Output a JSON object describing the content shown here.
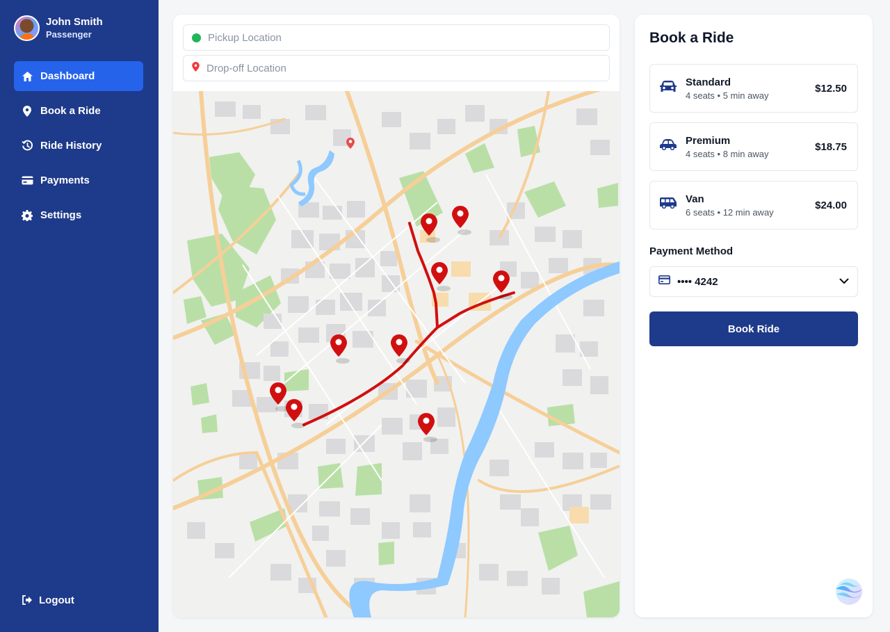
{
  "user": {
    "name": "John Smith",
    "role": "Passenger"
  },
  "nav": {
    "items": [
      {
        "label": "Dashboard",
        "icon": "home-icon",
        "active": true
      },
      {
        "label": "Book a Ride",
        "icon": "map-pin-icon"
      },
      {
        "label": "Ride History",
        "icon": "history-icon"
      },
      {
        "label": "Payments",
        "icon": "credit-card-icon"
      },
      {
        "label": "Settings",
        "icon": "gear-icon"
      }
    ],
    "logout": "Logout"
  },
  "search": {
    "pickup_placeholder": "Pickup Location",
    "dropoff_placeholder": "Drop-off Location"
  },
  "booking": {
    "title": "Book a Ride",
    "options": [
      {
        "name": "Standard",
        "meta": "4 seats • 5 min away",
        "price": "$12.50",
        "icon": "car-icon"
      },
      {
        "name": "Premium",
        "meta": "4 seats • 8 min away",
        "price": "$18.75",
        "icon": "premium-car-icon"
      },
      {
        "name": "Van",
        "meta": "6 seats • 12 min away",
        "price": "$24.00",
        "icon": "van-icon"
      }
    ],
    "payment_label": "Payment Method",
    "payment_value": "•••• 4242",
    "book_button": "Book Ride"
  },
  "colors": {
    "sidebar": "#1e3a8a",
    "active_nav": "#2563eb",
    "route": "#d10f0f",
    "river": "#8ec9ff",
    "park": "#b9dfa6",
    "road": "#f6cf98"
  }
}
